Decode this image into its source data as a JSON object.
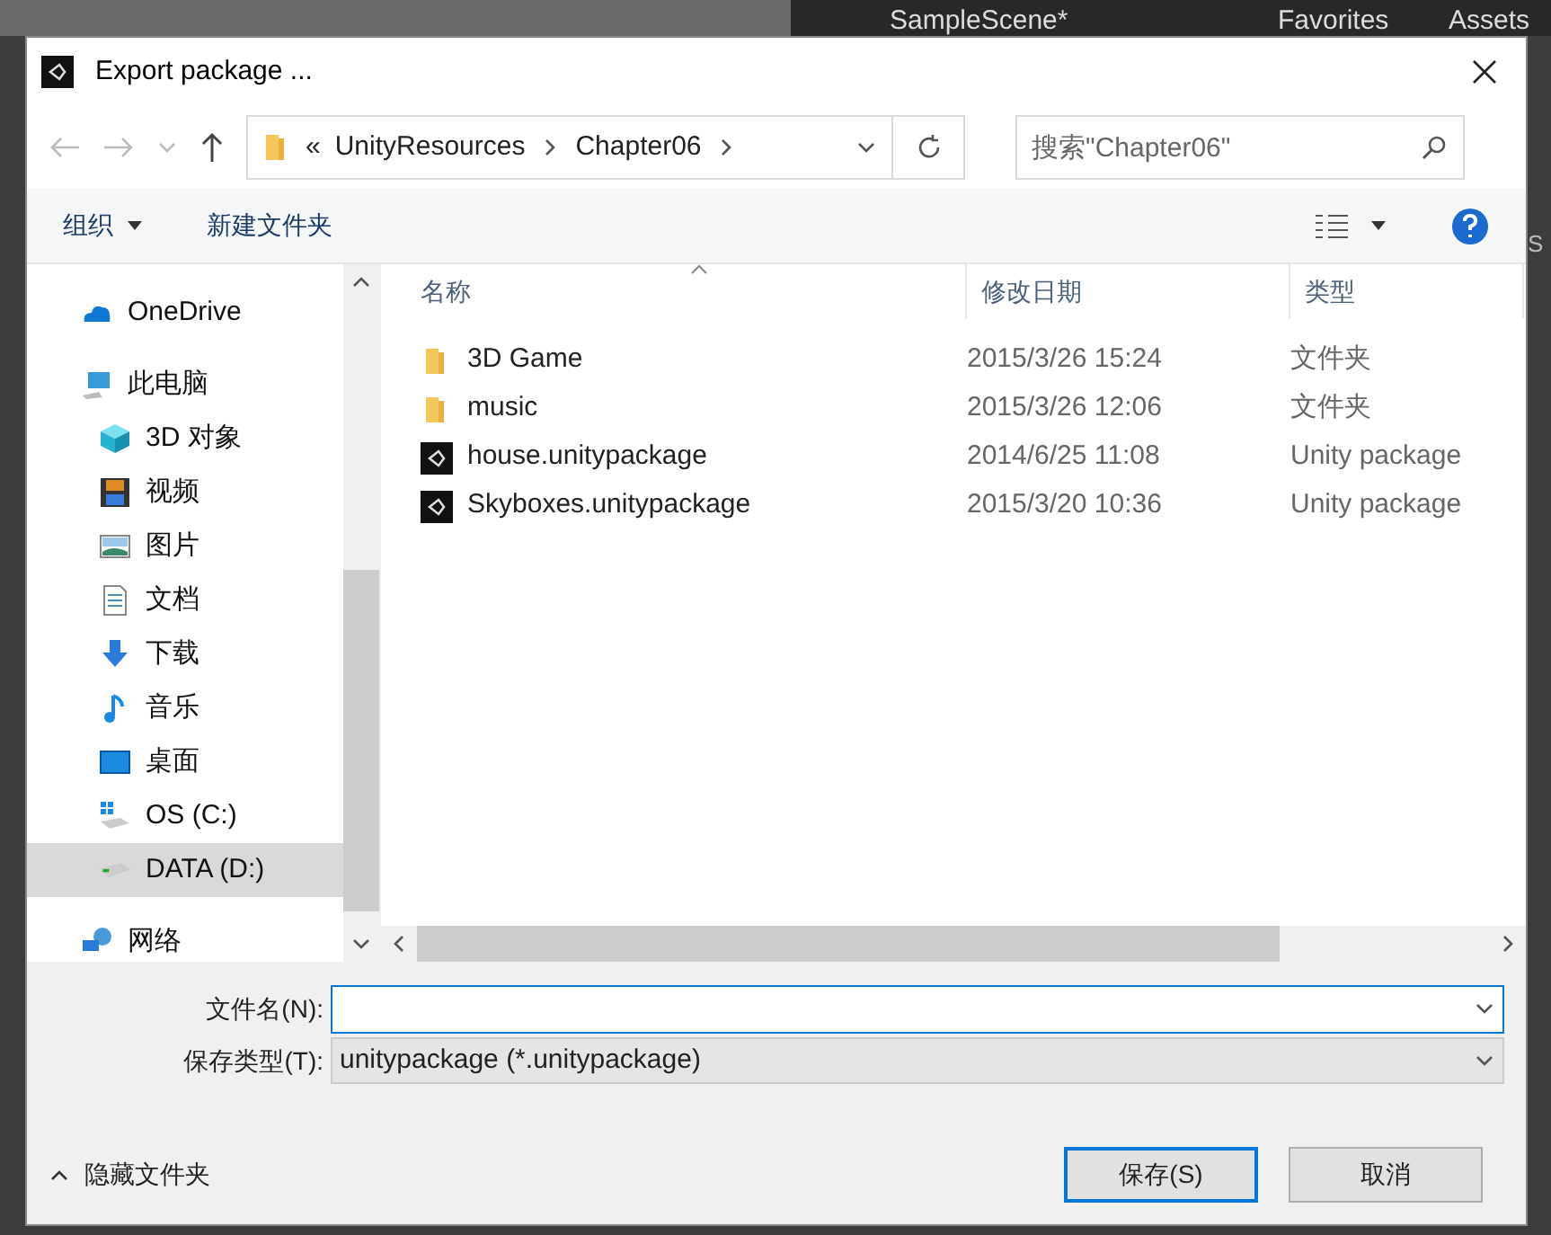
{
  "background": {
    "tabs": [
      "SampleScene*",
      "Favorites",
      "Assets"
    ],
    "side_text": "S"
  },
  "window": {
    "title": "Export package ..."
  },
  "nav": {
    "breadcrumb": [
      "«",
      "UnityResources",
      "Chapter06"
    ],
    "search": {
      "placeholder": "搜索\"Chapter06\""
    }
  },
  "toolbar": {
    "organize": "组织",
    "new_folder": "新建文件夹"
  },
  "sidebar": {
    "items": [
      {
        "label": "OneDrive",
        "kind": "cloud",
        "selected": false
      },
      {
        "label": "此电脑",
        "kind": "pc",
        "selected": false,
        "children": [
          {
            "label": "3D 对象",
            "kind": "cube",
            "selected": false
          },
          {
            "label": "视频",
            "kind": "film",
            "selected": false
          },
          {
            "label": "图片",
            "kind": "image",
            "selected": false
          },
          {
            "label": "文档",
            "kind": "doc",
            "selected": false
          },
          {
            "label": "下载",
            "kind": "download",
            "selected": false
          },
          {
            "label": "音乐",
            "kind": "music",
            "selected": false
          },
          {
            "label": "桌面",
            "kind": "desktop",
            "selected": false
          },
          {
            "label": "OS (C:)",
            "kind": "drive-os",
            "selected": false
          },
          {
            "label": "DATA (D:)",
            "kind": "drive",
            "selected": true
          }
        ]
      },
      {
        "label": "网络",
        "kind": "network",
        "selected": false
      }
    ]
  },
  "table": {
    "columns": [
      "名称",
      "修改日期",
      "类型"
    ],
    "rows": [
      {
        "kind": "folder",
        "name": "3D Game",
        "date": "2015/3/26 15:24",
        "type": "文件夹"
      },
      {
        "kind": "folder",
        "name": "music",
        "date": "2015/3/26 12:06",
        "type": "文件夹"
      },
      {
        "kind": "package",
        "name": "house.unitypackage",
        "date": "2014/6/25 11:08",
        "type": "Unity package"
      },
      {
        "kind": "package",
        "name": "Skyboxes.unitypackage",
        "date": "2015/3/20 10:36",
        "type": "Unity package"
      }
    ]
  },
  "form": {
    "filename_label": "文件名(N):",
    "filetype_label": "保存类型(T):",
    "filetype": "unitypackage (*.unitypackage)"
  },
  "footer": {
    "hide_folders": "隐藏文件夹",
    "buttons": [
      "保存(S)",
      "取消"
    ]
  }
}
